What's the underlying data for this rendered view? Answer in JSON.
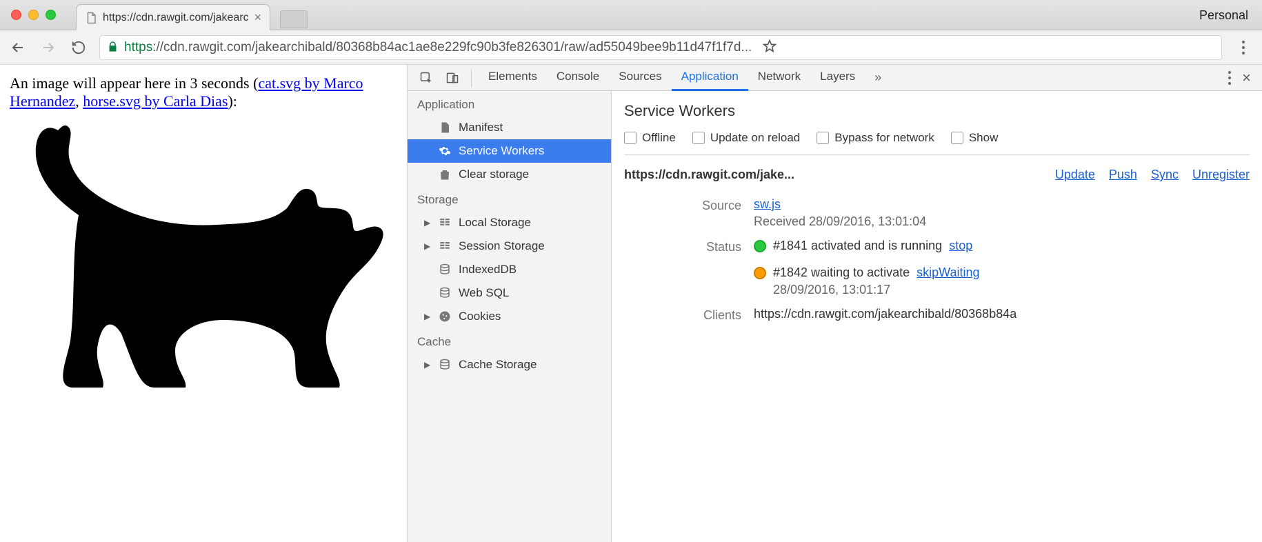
{
  "tab_strip": {
    "tab_title": "https://cdn.rawgit.com/jakearc",
    "profile": "Personal"
  },
  "omnibox": {
    "scheme": "https",
    "rest": "://cdn.rawgit.com/jakearchibald/80368b84ac1ae8e229fc90b3fe826301/raw/ad55049bee9b11d47f1f7d..."
  },
  "page": {
    "intro_prefix": "An image will appear here in 3 seconds (",
    "link1": "cat.svg by Marco Hernandez",
    "sep": ", ",
    "link2": "horse.svg by Carla Dias",
    "intro_suffix": "):"
  },
  "devtools": {
    "tabs": [
      "Elements",
      "Console",
      "Sources",
      "Application",
      "Network",
      "Layers"
    ],
    "active_tab": "Application",
    "sidebar": {
      "groups": [
        {
          "title": "Application",
          "items": [
            {
              "icon": "manifest",
              "label": "Manifest"
            },
            {
              "icon": "gear",
              "label": "Service Workers",
              "selected": true
            },
            {
              "icon": "trash",
              "label": "Clear storage"
            }
          ]
        },
        {
          "title": "Storage",
          "items": [
            {
              "icon": "table",
              "label": "Local Storage",
              "expandable": true
            },
            {
              "icon": "table",
              "label": "Session Storage",
              "expandable": true
            },
            {
              "icon": "db",
              "label": "IndexedDB"
            },
            {
              "icon": "db",
              "label": "Web SQL"
            },
            {
              "icon": "cookie",
              "label": "Cookies",
              "expandable": true
            }
          ]
        },
        {
          "title": "Cache",
          "items": [
            {
              "icon": "db",
              "label": "Cache Storage",
              "expandable": true
            }
          ]
        }
      ]
    },
    "sw_panel": {
      "title": "Service Workers",
      "checks": [
        "Offline",
        "Update on reload",
        "Bypass for network",
        "Show"
      ],
      "origin": "https://cdn.rawgit.com/jake...",
      "actions": [
        "Update",
        "Push",
        "Sync",
        "Unregister"
      ],
      "rows": {
        "source_label": "Source",
        "source_link": "sw.js",
        "received": "Received 28/09/2016, 13:01:04",
        "status_label": "Status",
        "status1": "#1841 activated and is running",
        "status1_action": "stop",
        "status2": "#1842 waiting to activate",
        "status2_action": "skipWaiting",
        "status2_ts": "28/09/2016, 13:01:17",
        "clients_label": "Clients",
        "clients_val": "https://cdn.rawgit.com/jakearchibald/80368b84a"
      }
    }
  }
}
